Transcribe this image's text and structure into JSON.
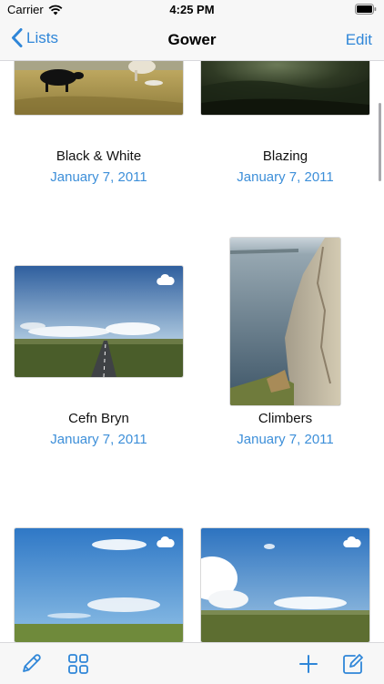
{
  "status_bar": {
    "carrier": "Carrier",
    "time": "4:25 PM"
  },
  "nav": {
    "back_label": "Lists",
    "title": "Gower",
    "edit_label": "Edit"
  },
  "items": [
    {
      "title": "Black & White",
      "date": "January 7, 2011",
      "cloud": false,
      "icon": "photo-sheep"
    },
    {
      "title": "Blazing",
      "date": "January 7, 2011",
      "cloud": false,
      "icon": "photo-dark-hillside"
    },
    {
      "title": "Cefn Bryn",
      "date": "January 7, 2011",
      "cloud": true,
      "icon": "photo-road"
    },
    {
      "title": "Climbers",
      "date": "January 7, 2011",
      "cloud": false,
      "icon": "photo-cliff"
    },
    {
      "title": "",
      "date": "",
      "cloud": true,
      "icon": "photo-sky"
    },
    {
      "title": "",
      "date": "",
      "cloud": true,
      "icon": "photo-clouds-field"
    }
  ],
  "toolbar": {
    "items": [
      "pencil-icon",
      "grid-icon",
      "plus-icon",
      "compose-icon"
    ]
  },
  "colors": {
    "accent": "#2f86d8",
    "date_text": "#3d8fd9",
    "bar_background": "#f7f7f7"
  }
}
